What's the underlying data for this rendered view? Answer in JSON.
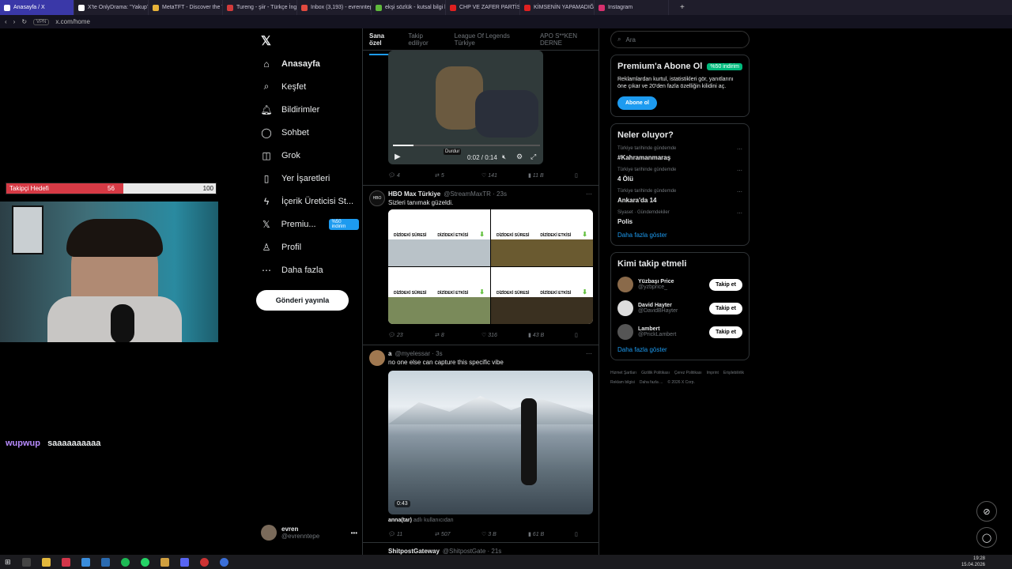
{
  "browser": {
    "tabs": [
      {
        "label": "Anasayfa / X",
        "color": "#ffffff",
        "active": true
      },
      {
        "label": "X'te OnlyDrama: \"YakupT",
        "color": "#ffffff"
      },
      {
        "label": "MetaTFT - Discover the T",
        "color": "#e8b339"
      },
      {
        "label": "Tureng - şiir - Türkçe İngil",
        "color": "#d23b3b"
      },
      {
        "label": "Inbox (3,193) - evrenntep",
        "color": "#e04a3f"
      },
      {
        "label": "ekşi sözlük - kutsal bilgi k",
        "color": "#5fb93c"
      },
      {
        "label": "CHP VE ZAFER PARTİSİN",
        "color": "#e02020"
      },
      {
        "label": "KİMSENİN YAPAMADIĞI O",
        "color": "#e02020"
      },
      {
        "label": "Instagram",
        "color": "#d6306e"
      }
    ],
    "new_tab": "+",
    "url": "x.com/home",
    "vpn": "VPN"
  },
  "overlay": {
    "goal_label": "Takipçi Hedefi",
    "goal_current": "56",
    "goal_target": "100",
    "goal_progress": 0.56,
    "chat_user": "wupwup",
    "chat_message": "saaaaaaaaaa"
  },
  "nav": {
    "items": [
      {
        "label": "Anasayfa",
        "icon": "home-icon",
        "glyph": "⌂"
      },
      {
        "label": "Keşfet",
        "icon": "search-icon",
        "glyph": "⌕"
      },
      {
        "label": "Bildirimler",
        "icon": "bell-icon",
        "glyph": "🔔︎"
      },
      {
        "label": "Sohbet",
        "icon": "chat-icon",
        "glyph": "◯"
      },
      {
        "label": "Grok",
        "icon": "grok-icon",
        "glyph": "◫"
      },
      {
        "label": "Yer İşaretleri",
        "icon": "bookmark-icon",
        "glyph": "▯"
      },
      {
        "label": "İçerik Üreticisi St...",
        "icon": "lightning-icon",
        "glyph": "ϟ"
      },
      {
        "label": "Premiu...",
        "icon": "x-icon",
        "glyph": "𝕏",
        "badge": "%50 indirim"
      },
      {
        "label": "Profil",
        "icon": "profile-icon",
        "glyph": "♙"
      },
      {
        "label": "Daha fazla",
        "icon": "more-icon",
        "glyph": "⋯"
      }
    ],
    "post_button": "Gönderi yayınla",
    "account": {
      "name": "evren",
      "handle": "@evrenntepe",
      "menu": "•••"
    }
  },
  "feed": {
    "tabs": [
      "Sana özel",
      "Takip ediliyor",
      "League Of Legends Türkiye",
      "APO S**KEN DERNE"
    ],
    "video_player": {
      "time": "0:02 / 0:14",
      "tooltip": "Durdur",
      "progress": 0.14
    },
    "first_stats": {
      "replies": "4",
      "reposts": "5",
      "likes": "141",
      "views": "11 B"
    },
    "tweets": [
      {
        "name": "HBO Max Türkiye",
        "handle": "@StreamMaxTR · 23s",
        "text": "Sizleri tanımak güzeldi.",
        "grid_label_a": "DİZİDEKİ SÜRESİ",
        "grid_label_b": "DİZİDEKİ ETKİSİ",
        "stats": {
          "replies": "23",
          "reposts": "8",
          "likes": "316",
          "views": "43 B"
        }
      },
      {
        "name": "a",
        "handle": "@myelessar · 3s",
        "text": "no one else can capture this specific vibe",
        "duration": "0:43",
        "sound": "anna(tar)",
        "sound_suffix": "adlı kullanıcıdan",
        "stats": {
          "replies": "11",
          "reposts": "507",
          "likes": "3 B",
          "views": "61 B"
        }
      },
      {
        "name": "ShitpostGateway",
        "handle": "@ShitpostGate · 21s"
      }
    ]
  },
  "right": {
    "search_placeholder": "Ara",
    "premium": {
      "title": "Premium'a Abone Ol",
      "badge": "%50 indirim",
      "body": "Reklamlardan kurtul, istatistikleri gör, yanıtlarını öne çıkar ve 20'den fazla özelliğin kilidini aç.",
      "button": "Abone ol"
    },
    "trends": {
      "title": "Neler oluyor?",
      "items": [
        {
          "category": "Türkiye tarihinde gündemde",
          "name": "#Kahramanmaraş"
        },
        {
          "category": "Türkiye tarihinde gündemde",
          "name": "4 Ölü"
        },
        {
          "category": "Türkiye tarihinde gündemde",
          "name": "Ankara'da 14"
        },
        {
          "category": "Siyaset · Gündemdekiler",
          "name": "Polis"
        }
      ],
      "more": "Daha fazla göster"
    },
    "who_to_follow": {
      "title": "Kimi takip etmeli",
      "users": [
        {
          "name": "Yüzbaşı Price",
          "handle": "@yzbprice_",
          "button": "Takip et"
        },
        {
          "name": "David Hayter",
          "handle": "@DavidBHayter",
          "button": "Takip et"
        },
        {
          "name": "Lambert",
          "handle": "@PrickLambert",
          "button": "Takip et"
        }
      ],
      "more": "Daha fazla göster"
    },
    "footer": [
      "Hizmet Şartları",
      "Gizlilik Politikası",
      "Çerez Politikası",
      "Imprint",
      "Erişilebilirlik",
      "Reklam bilgisi",
      "Daha fazla ...",
      "© 2026 X Corp."
    ]
  },
  "taskbar": {
    "time": "19:28",
    "date": "15.04.2026"
  }
}
